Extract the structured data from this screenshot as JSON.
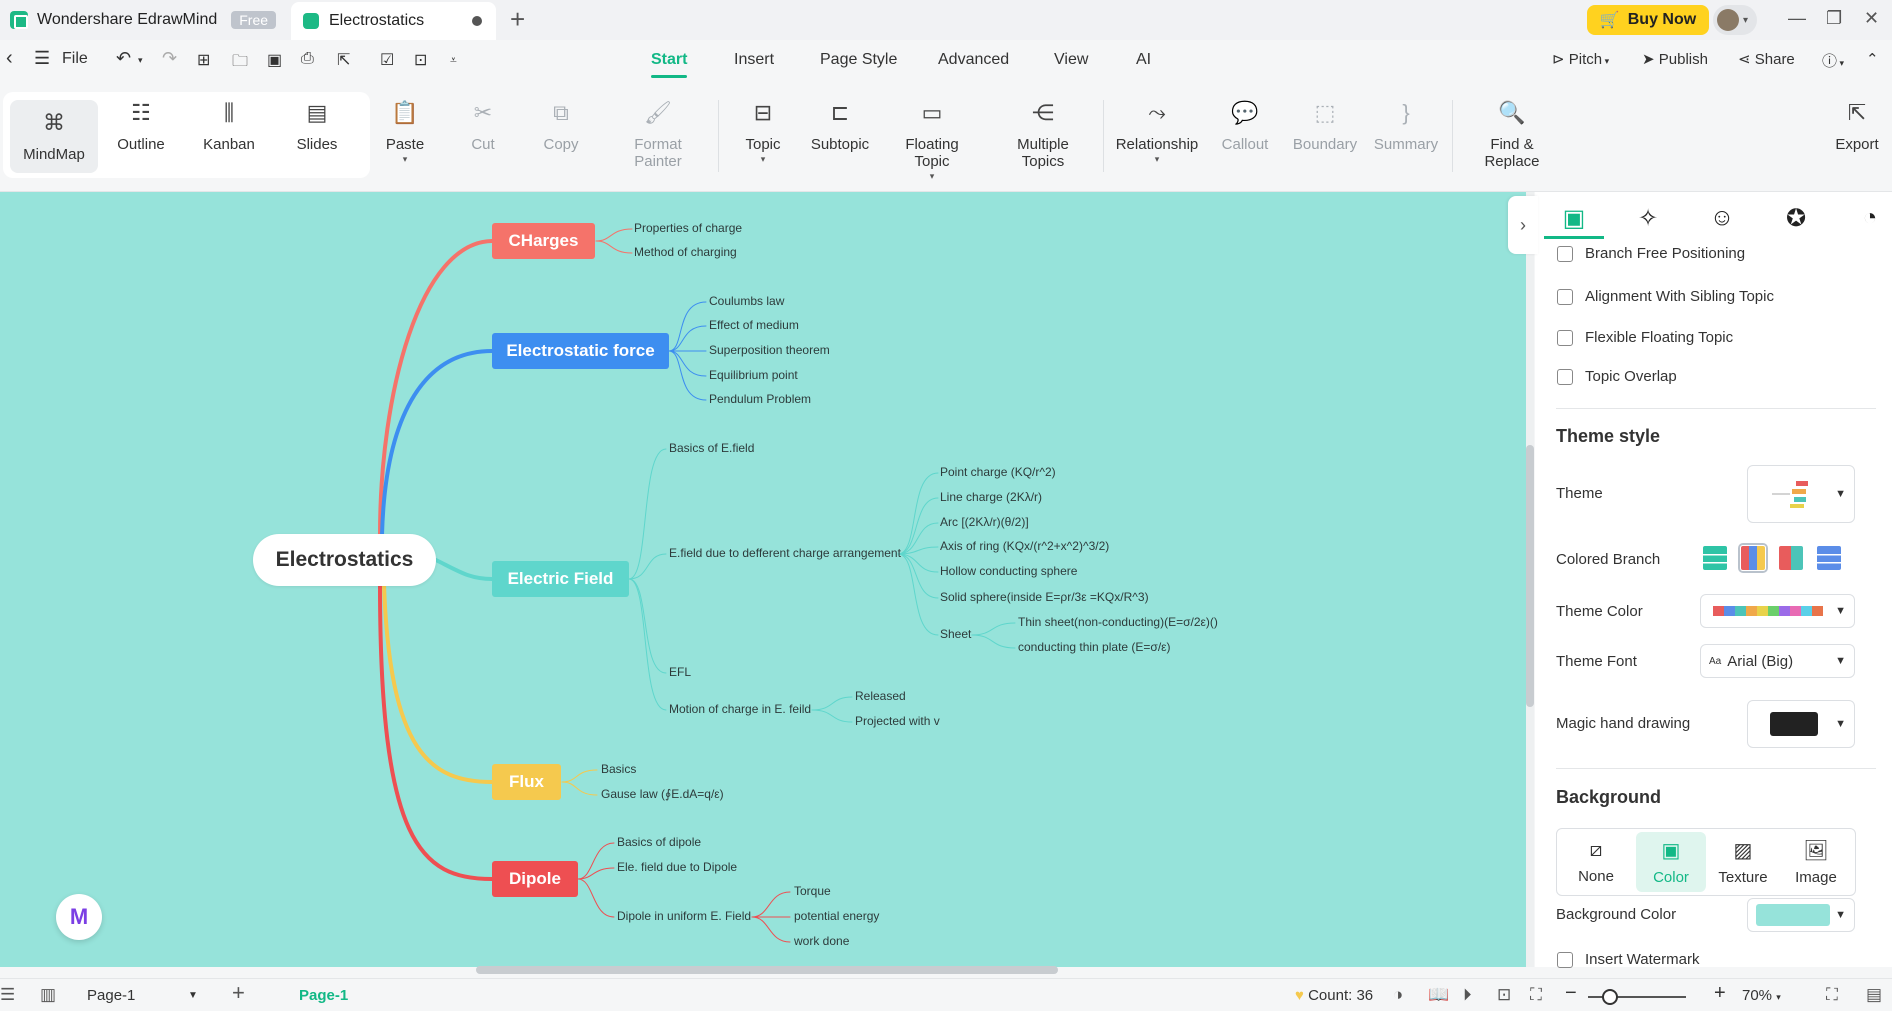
{
  "app": {
    "name": "Wondershare EdrawMind",
    "badge": "Free",
    "doc_tab": "Electrostatics",
    "buy_now": "Buy Now"
  },
  "menubar": {
    "file": "File",
    "tabs": [
      "Start",
      "Insert",
      "Page Style",
      "Advanced",
      "View",
      "AI"
    ],
    "right": {
      "pitch": "Pitch",
      "publish": "Publish",
      "share": "Share"
    }
  },
  "ribbon": {
    "views": [
      "MindMap",
      "Outline",
      "Kanban",
      "Slides"
    ],
    "buttons": [
      "Paste",
      "Cut",
      "Copy",
      "Format Painter",
      "Topic",
      "Subtopic",
      "Floating Topic",
      "Multiple Topics",
      "Relationship",
      "Callout",
      "Boundary",
      "Summary",
      "Find & Replace",
      "Export"
    ]
  },
  "mindmap": {
    "central": "Electrostatics",
    "topics": [
      {
        "label": "CHarges",
        "color": "#f5736a"
      },
      {
        "label": "Electrostatic force",
        "color": "#3d8ef0"
      },
      {
        "label": "Electric Field",
        "color": "#5fd6cc"
      },
      {
        "label": "Flux",
        "color": "#f5c94e"
      },
      {
        "label": "Dipole",
        "color": "#ee4f52"
      }
    ],
    "charges": [
      "Properties of charge",
      "Method of charging"
    ],
    "force": [
      "Coulumbs law",
      "Effect of medium",
      "Superposition theorem",
      "Equilibrium point",
      "Pendulum Problem"
    ],
    "field": {
      "basics": "Basics of E.field",
      "arrangement": "E.field due to defferent charge arrangement",
      "arrangement_items": [
        "Point charge (KQ/r^2)",
        "Line charge (2Kλ/r)",
        "Arc [(2Kλ/r)(θ/2)]",
        "Axis of ring (KQx/(r^2+x^2)^3/2)",
        "Hollow conducting sphere",
        "Solid sphere(inside E=ρr/3ε =KQx/R^3)"
      ],
      "sheet": "Sheet",
      "sheet_items": [
        "Thin sheet(non-conducting)(E=σ/2ε)()",
        "conducting thin plate (E=σ/ε)"
      ],
      "efl": "EFL",
      "motion": "Motion of charge in E. feild",
      "motion_items": [
        "Released",
        "Projected with v"
      ]
    },
    "flux": [
      "Basics",
      "Gause law (∮E.dA=q/ε)"
    ],
    "dipole": {
      "items": [
        "Basics of dipole",
        "Ele. field due to Dipole",
        "Dipole in uniform E. Field"
      ],
      "uniform_items": [
        "Torque",
        "potential energy",
        "work done"
      ]
    }
  },
  "panel": {
    "checks": [
      "Branch Free Positioning",
      "Alignment With Sibling Topic",
      "Flexible Floating Topic",
      "Topic Overlap"
    ],
    "theme_style": "Theme style",
    "theme": "Theme",
    "colored_branch": "Colored Branch",
    "theme_color": "Theme Color",
    "theme_font": "Theme Font",
    "theme_font_value": "Arial (Big)",
    "font_prefix": "Aa",
    "magic_hand": "Magic hand drawing",
    "background": "Background",
    "bg_options": [
      "None",
      "Color",
      "Texture",
      "Image"
    ],
    "background_color": "Background Color",
    "background_color_value": "#96e3da",
    "insert_watermark": "Insert Watermark",
    "theme_colors": [
      "#e85c5c",
      "#5b8de8",
      "#4cc4b8",
      "#f0a84a",
      "#e8d24a",
      "#6bcf6b",
      "#9b6be8",
      "#e86bb4",
      "#5ad0e8",
      "#e8744a"
    ]
  },
  "status": {
    "page_select": "Page-1",
    "page_tab": "Page-1",
    "count": "Count: 36",
    "zoom": "70%"
  }
}
